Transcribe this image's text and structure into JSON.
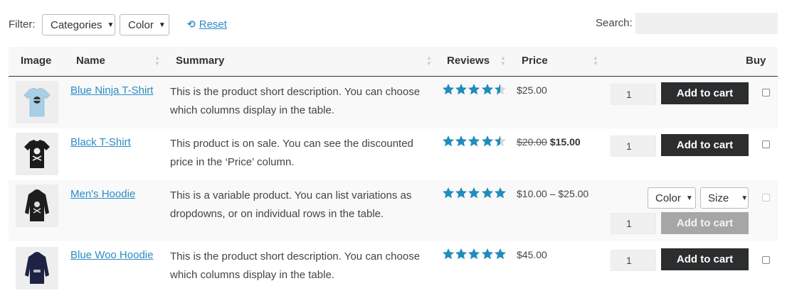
{
  "filter": {
    "label": "Filter:",
    "categories": "Categories",
    "color": "Color",
    "reset": "Reset",
    "search_label": "Search:",
    "search_value": ""
  },
  "columns": {
    "image": "Image",
    "name": "Name",
    "summary": "Summary",
    "reviews": "Reviews",
    "price": "Price",
    "buy": "Buy"
  },
  "rows": [
    {
      "name": "Blue Ninja T-Shirt",
      "summary": "This is the product short description. You can choose which columns display in the table.",
      "rating": 4.5,
      "price": "$25.00",
      "quantity": "1",
      "button": "Add to cart",
      "image_color": "#a9cfe6",
      "image_icon": "tshirt-icon"
    },
    {
      "name": "Black T-Shirt",
      "summary": "This product is on sale. You can see the discounted price in the ‘Price’ column.",
      "rating": 4.5,
      "old_price": "$20.00",
      "price": "$15.00",
      "quantity": "1",
      "button": "Add to cart",
      "image_color": "#1b1b1b",
      "image_icon": "tshirt-icon"
    },
    {
      "name": "Men's Hoodie",
      "summary": "This is a variable product. You can list variations as dropdowns, or on individual rows in the table.",
      "rating": 5,
      "price": "$10.00 – $25.00",
      "variation_color": "Color",
      "variation_size": "Size",
      "quantity": "1",
      "button": "Add to cart",
      "image_color": "#1e1e1e",
      "image_icon": "hoodie-icon"
    },
    {
      "name": "Blue Woo Hoodie",
      "summary": "This is the product short description. You can choose which columns display in the table.",
      "rating": 5,
      "price": "$45.00",
      "quantity": "1",
      "button": "Add to cart",
      "image_color": "#1d2344",
      "image_icon": "hoodie-icon"
    }
  ],
  "colors": {
    "link": "#2b8cc4",
    "star": "#1e8cbe",
    "button": "#2b2d2f",
    "button_disabled": "#a6a6a6"
  }
}
